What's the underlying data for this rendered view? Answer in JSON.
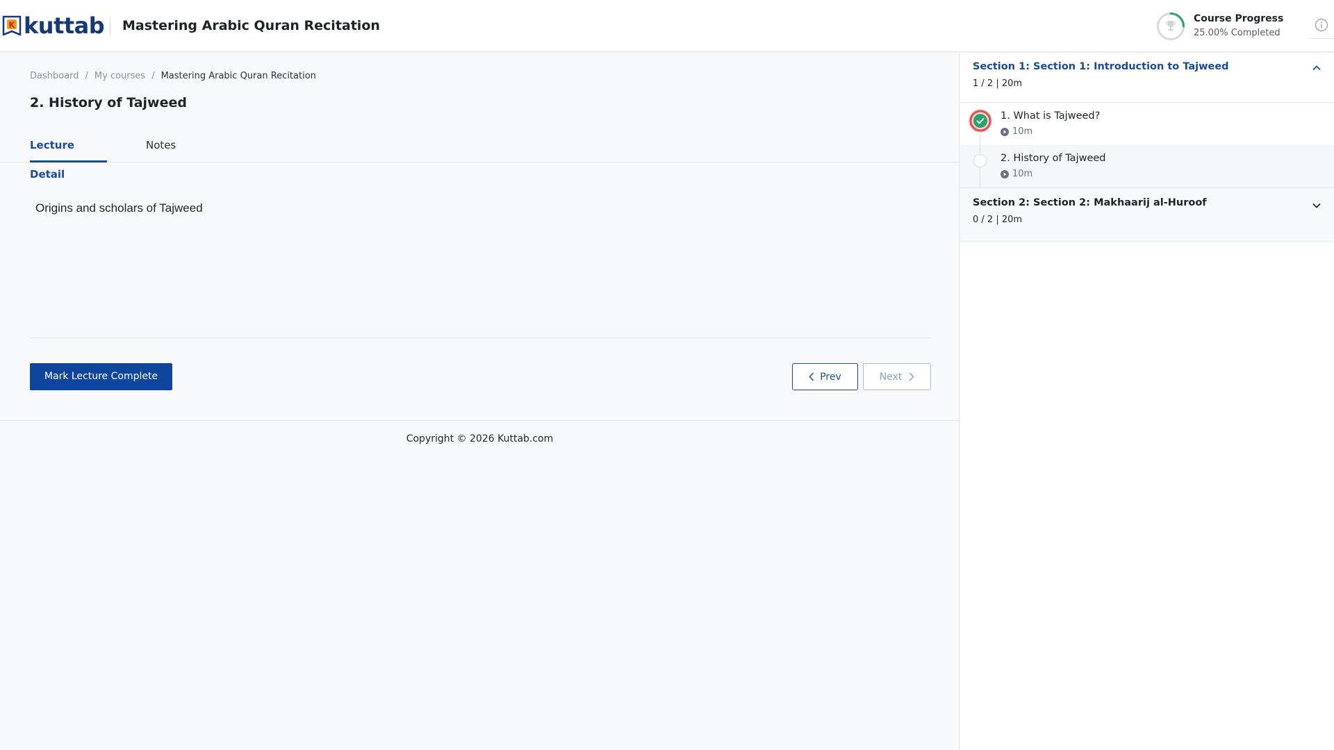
{
  "header": {
    "logo_text": "kuttab",
    "course_title": "Mastering Arabic Quran Recitation",
    "progress_label": "Course Progress",
    "progress_text": "25.00% Completed",
    "progress_value": 0.25
  },
  "breadcrumb": [
    {
      "label": "Dashboard"
    },
    {
      "label": "My courses"
    },
    {
      "label": "Mastering Arabic Quran Recitation"
    }
  ],
  "breadcrumb_separator": "/",
  "lecture": {
    "title": "2. History of Tajweed",
    "description": "Origins and scholars of Tajweed"
  },
  "tabs": [
    {
      "label": "Lecture Detail",
      "active": true
    },
    {
      "label": "Notes",
      "active": false
    }
  ],
  "actions": {
    "mark_complete": "Mark Lecture Complete",
    "prev": "Prev",
    "next": "Next"
  },
  "footer": {
    "copyright": "Copyright © 2026 Kuttab.com"
  },
  "sidebar": {
    "sections": [
      {
        "title": "Section 1: Section 1: Introduction to Tajweed",
        "meta": "1 / 2 | 20m",
        "expanded": true,
        "lectures": [
          {
            "name": "1. What is Tajweed?",
            "duration": "10m",
            "completed": true
          },
          {
            "name": "2. History of Tajweed",
            "duration": "10m",
            "completed": false
          }
        ]
      },
      {
        "title": "Section 2: Section 2: Makhaarij al-Huroof",
        "meta": "0 / 2 | 20m",
        "expanded": false
      }
    ]
  },
  "colors": {
    "primary": "#0f459c",
    "accent_text": "#1a4a9c",
    "progress_green": "#27a36b",
    "completed_ring": "#e0504f"
  },
  "icons": {
    "logo": "book-logo-icon",
    "progress": "trophy-icon",
    "info": "info-circle-icon",
    "prev": "chevron-left-icon",
    "next": "chevron-right-icon",
    "section_open": "chevron-up-icon",
    "section_closed": "chevron-down-icon",
    "lecture_completed": "check-circle-icon",
    "duration": "play-circle-icon"
  }
}
